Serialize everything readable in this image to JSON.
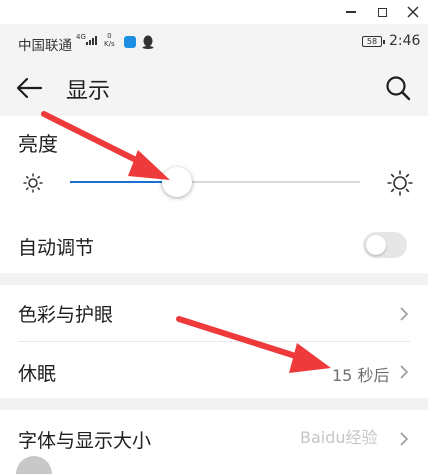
{
  "status": {
    "carrier": "中国联通",
    "signal_type": "4G",
    "net_speed_value": "0",
    "net_speed_unit": "K/s",
    "battery": "58",
    "time": "2:46"
  },
  "header": {
    "title": "显示"
  },
  "brightness": {
    "title": "亮度",
    "level_fraction": 0.37
  },
  "settings": {
    "auto_adjust_label": "自动调节",
    "auto_adjust_on": false,
    "color_eye_label": "色彩与护眼",
    "sleep_label": "休眠",
    "sleep_value": "15 秒后",
    "font_size_label": "字体与显示大小"
  },
  "watermark": "Baidu经验",
  "colors": {
    "accent": "#1a6fd0",
    "annotation_arrow": "#ee3a3a",
    "background_gray": "#f4f4f4"
  },
  "icons": [
    "minimize-icon",
    "maximize-icon",
    "close-icon",
    "back-arrow-icon",
    "search-icon",
    "sun-small-icon",
    "sun-large-icon",
    "chevron-right-icon"
  ]
}
